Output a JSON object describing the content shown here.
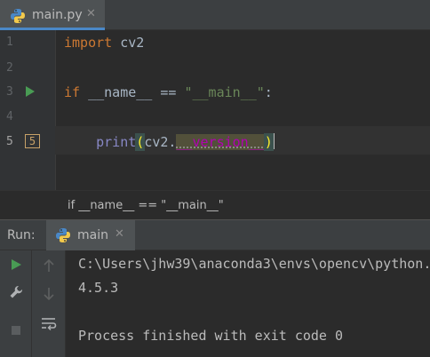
{
  "editor_tab": {
    "filename": "main.py",
    "icon": "python-file-icon",
    "close_glyph": "✕"
  },
  "gutter": {
    "lines": [
      "1",
      "2",
      "3",
      "4",
      "5"
    ],
    "bookmark_label": "5"
  },
  "code": {
    "line1": {
      "keyword": "import",
      "rest": " cv2"
    },
    "line3": {
      "keyword": "if",
      "name": " __name__ == ",
      "string": "\"__main__\"",
      "colon": ":"
    },
    "line5": {
      "indent": "    ",
      "func": "print",
      "open_paren": "(",
      "obj": "cv2.",
      "attr": "__version__",
      "close_paren": ")"
    }
  },
  "breadcrumb": {
    "text": "if __name__ == \"__main__\""
  },
  "run_panel": {
    "label": "Run:",
    "tab_label": "main",
    "close_glyph": "✕"
  },
  "console": {
    "lines": [
      "C:\\Users\\jhw39\\anaconda3\\envs\\opencv\\python.exe",
      "4.5.3",
      "",
      "Process finished with exit code 0"
    ]
  },
  "colors": {
    "keyword": "#cc7832",
    "string": "#6a8759",
    "builtin": "#8888c6",
    "dunder": "#b200b2",
    "run_green": "#499c54",
    "accent_blue": "#4a88c7"
  }
}
